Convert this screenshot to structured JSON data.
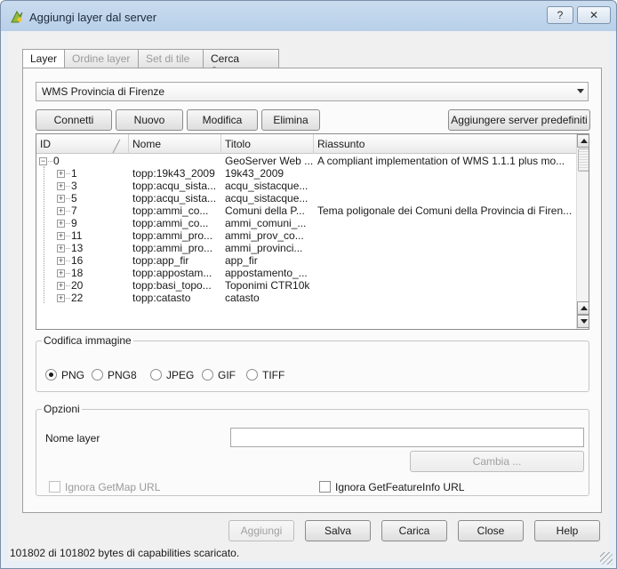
{
  "window": {
    "title": "Aggiungi layer dal server",
    "help_label": "?",
    "close_label": "✕"
  },
  "tabs": [
    "Layer",
    "Ordine layer",
    "Set di tile",
    "Cerca Server"
  ],
  "server_combo": {
    "selected": "WMS Provincia di Firenze"
  },
  "buttons": {
    "connect": "Connetti",
    "new": "Nuovo",
    "edit": "Modifica",
    "delete": "Elimina",
    "add_default": "Aggiungere server predefiniti"
  },
  "tree": {
    "columns": [
      "ID",
      "Nome",
      "Titolo",
      "Riassunto"
    ],
    "rows": [
      {
        "id": "0",
        "nome": "",
        "titolo": "GeoServer Web ...",
        "riassunto": "A compliant implementation of WMS 1.1.1 plus mo..."
      },
      {
        "id": "1",
        "nome": "topp:19k43_2009",
        "titolo": "19k43_2009",
        "riassunto": ""
      },
      {
        "id": "3",
        "nome": "topp:acqu_sista...",
        "titolo": "acqu_sistacque...",
        "riassunto": ""
      },
      {
        "id": "5",
        "nome": "topp:acqu_sista...",
        "titolo": "acqu_sistacque...",
        "riassunto": ""
      },
      {
        "id": "7",
        "nome": "topp:ammi_co...",
        "titolo": "Comuni della P...",
        "riassunto": "Tema poligonale dei Comuni della Provincia di Firen..."
      },
      {
        "id": "9",
        "nome": "topp:ammi_co...",
        "titolo": "ammi_comuni_...",
        "riassunto": ""
      },
      {
        "id": "11",
        "nome": "topp:ammi_pro...",
        "titolo": "ammi_prov_co...",
        "riassunto": ""
      },
      {
        "id": "13",
        "nome": "topp:ammi_pro...",
        "titolo": "ammi_provinci...",
        "riassunto": ""
      },
      {
        "id": "16",
        "nome": "topp:app_fir",
        "titolo": "app_fir",
        "riassunto": ""
      },
      {
        "id": "18",
        "nome": "topp:appostam...",
        "titolo": "appostamento_...",
        "riassunto": ""
      },
      {
        "id": "20",
        "nome": "topp:basi_topo...",
        "titolo": "Toponimi CTR10k",
        "riassunto": ""
      },
      {
        "id": "22",
        "nome": "topp:catasto",
        "titolo": "catasto",
        "riassunto": ""
      }
    ]
  },
  "encoding": {
    "title": "Codifica immagine",
    "options": [
      "PNG",
      "PNG8",
      "JPEG",
      "GIF",
      "TIFF"
    ],
    "selected": "PNG"
  },
  "options": {
    "title": "Opzioni",
    "layer_name_label": "Nome layer",
    "layer_name_value": "",
    "change_button": "Cambia ...",
    "ignore_getmap": "Ignora GetMap URL",
    "ignore_getfeatureinfo": "Ignora GetFeatureInfo URL"
  },
  "footer": {
    "add": "Aggiungi",
    "save": "Salva",
    "load": "Carica",
    "close": "Close",
    "help": "Help"
  },
  "status": "101802 di 101802 bytes di capabilities scaricato."
}
